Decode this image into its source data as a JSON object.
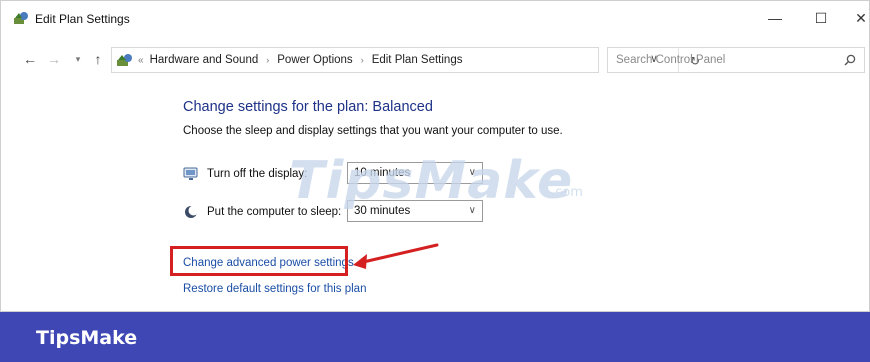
{
  "window": {
    "title": "Edit Plan Settings",
    "minimize_glyph": "—",
    "maximize_glyph": "☐",
    "close_glyph": "✕"
  },
  "nav": {
    "back_glyph": "←",
    "forward_glyph": "→",
    "recent_glyph": "▾",
    "up_glyph": "↑",
    "lead_sep": "«",
    "crumb_sep": "›",
    "breadcrumbs": [
      "Hardware and Sound",
      "Power Options",
      "Edit Plan Settings"
    ],
    "dropdown_glyph": "∨",
    "refresh_glyph": "↻"
  },
  "search": {
    "placeholder": "Search Control Panel"
  },
  "content": {
    "heading": "Change settings for the plan: Balanced",
    "subtext": "Choose the sleep and display settings that you want your computer to use.",
    "display_label": "Turn off the display:",
    "display_value": "10 minutes",
    "sleep_label": "Put the computer to sleep:",
    "sleep_value": "30 minutes",
    "select_chevron": "∨",
    "advanced_link": "Change advanced power settings",
    "restore_link": "Restore default settings for this plan"
  },
  "watermark": {
    "text": "TipsMake",
    "suffix": ".com"
  },
  "banner": {
    "text": "TipsMake"
  },
  "colors": {
    "heading": "#1e3287",
    "link": "#1a4ea6",
    "highlight": "#d42020",
    "banner": "#3f47b5"
  }
}
